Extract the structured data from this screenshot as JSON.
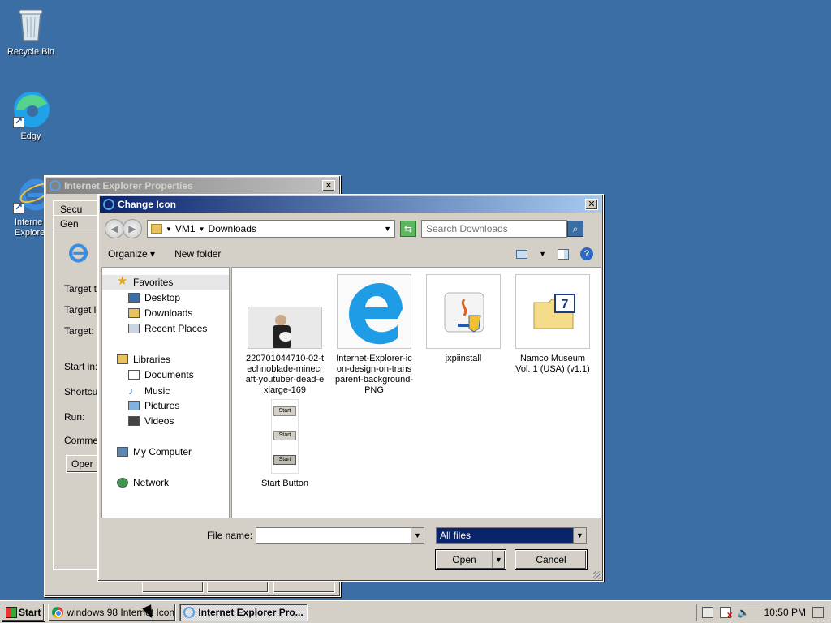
{
  "desktop": {
    "icons": [
      {
        "label": "Recycle Bin"
      },
      {
        "label": "Edgy"
      },
      {
        "label": "Interne\nExplore"
      }
    ]
  },
  "ie_properties": {
    "title": "Internet Explorer Properties",
    "tabs": [
      "Secu",
      "Gen"
    ],
    "labels": [
      "Target ty",
      "Target lo",
      "Target:",
      "Start in:",
      "Shortcut",
      "Run:",
      "Commer"
    ],
    "open_button": "Oper"
  },
  "change_icon": {
    "title": "Change Icon",
    "address": {
      "root": "VM1",
      "folder": "Downloads"
    },
    "search_placeholder": "Search Downloads",
    "toolbar": {
      "organize": "Organize",
      "new_folder": "New folder"
    },
    "nav": {
      "favorites": "Favorites",
      "favorites_items": [
        "Desktop",
        "Downloads",
        "Recent Places"
      ],
      "libraries": "Libraries",
      "libraries_items": [
        "Documents",
        "Music",
        "Pictures",
        "Videos"
      ],
      "computer": "My Computer",
      "network": "Network"
    },
    "files": [
      {
        "name": "220701044710-02-technoblade-minecraft-youtuber-dead-exlarge-169"
      },
      {
        "name": "Internet-Explorer-icon-design-on-transparent-background-PNG"
      },
      {
        "name": "jxpiinstall"
      },
      {
        "name": "Namco Museum Vol. 1 (USA) (v1.1)"
      },
      {
        "name": "Start Button",
        "thumb_labels": [
          "Start",
          "Start",
          "Start"
        ]
      }
    ],
    "file_name_label": "File name:",
    "file_name_value": "",
    "file_type": "All files",
    "open_button": "Open",
    "cancel_button": "Cancel"
  },
  "taskbar": {
    "start": "Start",
    "tasks": [
      {
        "label": "windows 98 Internet Icon..."
      },
      {
        "label": "Internet Explorer Pro..."
      }
    ],
    "clock": "10:50 PM"
  }
}
